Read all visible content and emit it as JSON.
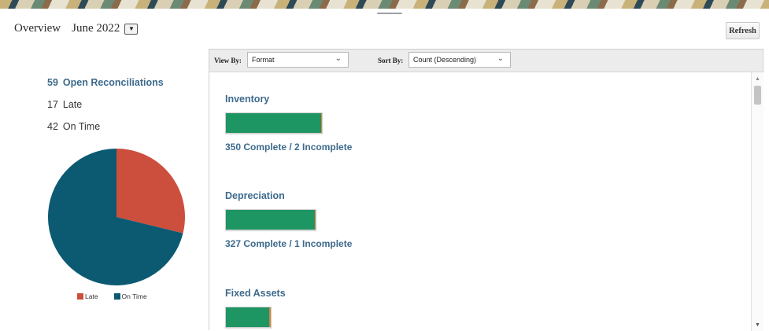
{
  "header": {
    "title": "Overview",
    "period": "June 2022",
    "period_dropdown_icon": "▼",
    "refresh_label": "Refresh"
  },
  "summary": {
    "open_count": "59",
    "open_label": "Open Reconciliations",
    "late_count": "17",
    "late_label": "Late",
    "ontime_count": "42",
    "ontime_label": "On Time"
  },
  "chart_data": {
    "type": "pie",
    "slices": [
      {
        "label": "Late",
        "value": 17,
        "color": "#cc4e3c"
      },
      {
        "label": "On Time",
        "value": 42,
        "color": "#0c5a72"
      }
    ],
    "legend": [
      "Late",
      "On Time"
    ]
  },
  "toolbar": {
    "view_by_label": "View By:",
    "view_by_value": "Format",
    "sort_by_label": "Sort By:",
    "sort_by_value": "Count (Descending)"
  },
  "groups": [
    {
      "name": "Inventory",
      "complete": 350,
      "incomplete": 2,
      "stats": "350 Complete / 2 Incomplete"
    },
    {
      "name": "Depreciation",
      "complete": 327,
      "incomplete": 1,
      "stats": "327 Complete / 1 Incomplete"
    },
    {
      "name": "Fixed Assets",
      "complete": 195,
      "incomplete": 7,
      "stats": ""
    }
  ],
  "colors": {
    "complete": "#1e9664",
    "incomplete": "#d9823a",
    "link": "#3d6a8c"
  }
}
